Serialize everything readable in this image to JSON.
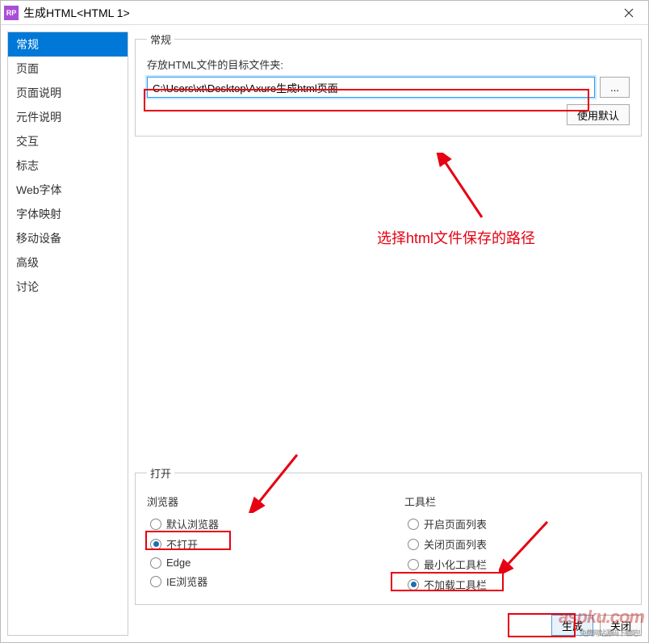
{
  "window": {
    "title": "生成HTML<HTML 1>",
    "app_icon_text": "RP"
  },
  "sidebar": {
    "items": [
      {
        "label": "常规",
        "selected": true
      },
      {
        "label": "页面"
      },
      {
        "label": "页面说明"
      },
      {
        "label": "元件说明"
      },
      {
        "label": "交互"
      },
      {
        "label": "标志"
      },
      {
        "label": "Web字体"
      },
      {
        "label": "字体映射"
      },
      {
        "label": "移动设备"
      },
      {
        "label": "高级"
      },
      {
        "label": "讨论"
      }
    ]
  },
  "main": {
    "group_title": "常规",
    "path_label": "存放HTML文件的目标文件夹:",
    "path_value": "C:\\Users\\xt\\Desktop\\Axure生成html页面",
    "browse_label": "...",
    "use_default_label": "使用默认",
    "annotation": "选择html文件保存的路径"
  },
  "open": {
    "group_title": "打开",
    "browser_title": "浏览器",
    "toolbar_title": "工具栏",
    "browser_options": [
      {
        "label": "默认浏览器",
        "checked": false
      },
      {
        "label": "不打开",
        "checked": true
      },
      {
        "label": "Edge",
        "checked": false
      },
      {
        "label": "IE浏览器",
        "checked": false
      }
    ],
    "toolbar_options": [
      {
        "label": "开启页面列表",
        "checked": false
      },
      {
        "label": "关闭页面列表",
        "checked": false
      },
      {
        "label": "最小化工具栏",
        "checked": false
      },
      {
        "label": "不加载工具栏",
        "checked": true
      }
    ]
  },
  "footer": {
    "generate_label": "生成",
    "close_label": "关闭"
  },
  "watermark": {
    "text": "aspku.com",
    "sub": "免费网站源码下载吧！"
  }
}
